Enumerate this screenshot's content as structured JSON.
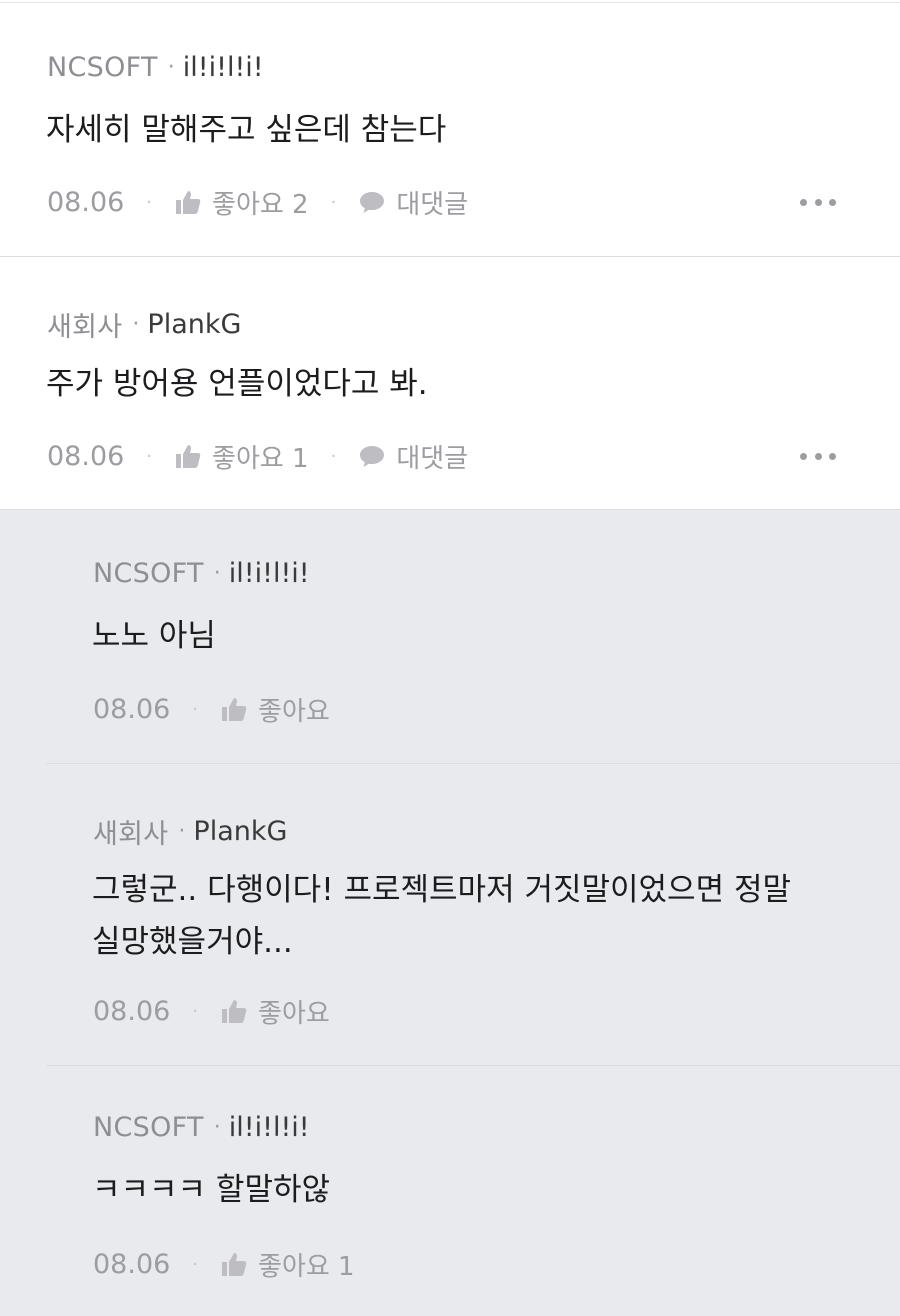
{
  "comments": [
    {
      "company": "NCSOFT",
      "nickname": "il!i!l!i!",
      "text": "자세히 말해주고 싶은데 참는다",
      "date": "08.06",
      "like_label": "좋아요 2",
      "reply_label": "대댓글",
      "more_icon": "more-dots-icon"
    },
    {
      "company": "새회사",
      "nickname": "PlankG",
      "text": "주가 방어용 언플이었다고 봐.",
      "date": "08.06",
      "like_label": "좋아요 1",
      "reply_label": "대댓글",
      "more_icon": "more-dots-icon"
    }
  ],
  "replies": [
    {
      "company": "NCSOFT",
      "nickname": "il!i!l!i!",
      "text": "노노 아님",
      "date": "08.06",
      "like_label": "좋아요"
    },
    {
      "company": "새회사",
      "nickname": "PlankG",
      "text": "그렇군.. 다행이다! 프로젝트마저 거짓말이었으면 정말\n실망했을거야...",
      "date": "08.06",
      "like_label": "좋아요"
    },
    {
      "company": "NCSOFT",
      "nickname": "il!i!l!i!",
      "text": "ㅋㅋㅋㅋ 할말하않",
      "date": "08.06",
      "like_label": "좋아요 1"
    }
  ],
  "colors": {
    "reply_background": "#e9eaee",
    "muted_text": "#9c9ca1",
    "body_text": "#1c1c1e",
    "icon": "#bdbdc2"
  },
  "icons": {
    "separator": "·",
    "like": "thumbs-up-icon",
    "reply": "speech-bubble-icon"
  }
}
